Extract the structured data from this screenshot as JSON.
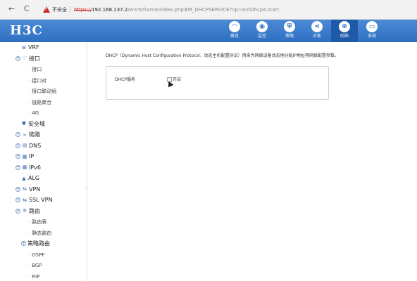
{
  "browser": {
    "back_icon": "←",
    "reload_icon": "C",
    "insecure_label": "不安全",
    "url_scheme": "https://",
    "url_host": "192.168.137.2",
    "url_path": "/wnm/frame/index.php#M_DHCPSERVICE?np=extDhcp4.start"
  },
  "header": {
    "logo": "H3C",
    "nav": [
      {
        "label": "概览",
        "icon": "overview-icon",
        "glyph": "◠",
        "active": false
      },
      {
        "label": "监控",
        "icon": "monitor-icon",
        "glyph": "◉",
        "active": false
      },
      {
        "label": "策略",
        "icon": "policy-shield-icon",
        "glyph": "⛨",
        "active": false
      },
      {
        "label": "对象",
        "icon": "object-share-icon",
        "glyph": "⋖",
        "active": false
      },
      {
        "label": "网络",
        "icon": "network-globe-icon",
        "glyph": "⊕",
        "active": true
      },
      {
        "label": "系统",
        "icon": "system-monitor-icon",
        "glyph": "▭",
        "active": false
      }
    ],
    "colors": {
      "bar": "#3a7bcc",
      "active": "#1f5aa8"
    }
  },
  "sidebar": {
    "items": [
      {
        "label": "VRF",
        "level": 1,
        "expander": "",
        "icon": "⊞",
        "icon_name": "vrf-icon"
      },
      {
        "label": "接口",
        "level": 0,
        "expander": "+",
        "icon": "♡",
        "icon_name": "interface-icon"
      },
      {
        "label": "接口",
        "level": 2,
        "expander": "",
        "icon": "",
        "icon_name": ""
      },
      {
        "label": "接口对",
        "level": 2,
        "expander": "",
        "icon": "",
        "icon_name": ""
      },
      {
        "label": "接口联动组",
        "level": 2,
        "expander": "",
        "icon": "",
        "icon_name": ""
      },
      {
        "label": "链路聚合",
        "level": 2,
        "expander": "",
        "icon": "",
        "icon_name": ""
      },
      {
        "label": "4G",
        "level": 2,
        "expander": "",
        "icon": "",
        "icon_name": ""
      },
      {
        "label": "安全域",
        "level": 1,
        "expander": "",
        "icon": "⛊",
        "icon_name": "security-zone-icon"
      },
      {
        "label": "链路",
        "level": 0,
        "expander": "+",
        "icon": "∞",
        "icon_name": "link-icon"
      },
      {
        "label": "DNS",
        "level": 0,
        "expander": "+",
        "icon": "▤",
        "icon_name": "dns-icon"
      },
      {
        "label": "IP",
        "level": 0,
        "expander": "+",
        "icon": "▦",
        "icon_name": "ip-icon"
      },
      {
        "label": "IPv6",
        "level": 0,
        "expander": "+",
        "icon": "▦",
        "icon_name": "ipv6-icon"
      },
      {
        "label": "ALG",
        "level": 1,
        "expander": "",
        "icon": "▲",
        "icon_name": "alg-icon"
      },
      {
        "label": "VPN",
        "level": 0,
        "expander": "+",
        "icon": "⇆",
        "icon_name": "vpn-icon"
      },
      {
        "label": "SSL VPN",
        "level": 0,
        "expander": "+",
        "icon": "⇆",
        "icon_name": "ssl-vpn-icon"
      },
      {
        "label": "路由",
        "level": 0,
        "expander": "+",
        "icon": "✲",
        "icon_name": "route-icon"
      },
      {
        "label": "路由表",
        "level": 2,
        "expander": "",
        "icon": "",
        "icon_name": ""
      },
      {
        "label": "静态路由",
        "level": 2,
        "expander": "",
        "icon": "",
        "icon_name": ""
      },
      {
        "label": "策略路由",
        "level": 1,
        "expander": "+",
        "icon": "",
        "icon_name": ""
      },
      {
        "label": "OSPF",
        "level": 2,
        "expander": "",
        "icon": "",
        "icon_name": ""
      },
      {
        "label": "BGP",
        "level": 2,
        "expander": "",
        "icon": "",
        "icon_name": ""
      },
      {
        "label": "RIP",
        "level": 2,
        "expander": "",
        "icon": "",
        "icon_name": ""
      }
    ]
  },
  "main": {
    "description": "DHCP（Dynamic Host Configuration Protocol，动态主机配置协议）用来为网络设备动态地分配IP地址等网络配置参数。",
    "dhcp_service_label": "DHCP服务",
    "enable_label": "开启",
    "enable_checked": false
  }
}
